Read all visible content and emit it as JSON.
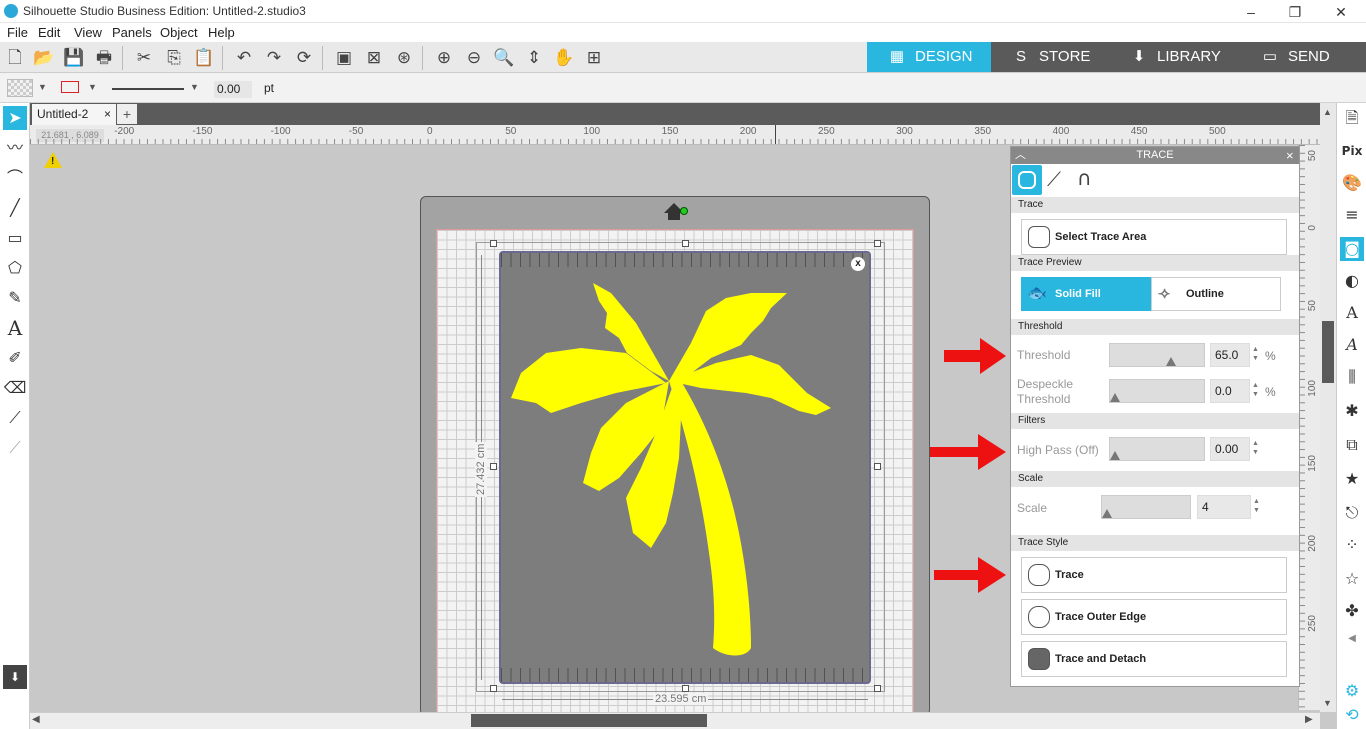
{
  "window": {
    "title": "Silhouette Studio Business Edition: Untitled-2.studio3",
    "min": "–",
    "restore": "❐",
    "close": "✕"
  },
  "menu": [
    "File",
    "Edit",
    "View",
    "Panels",
    "Object",
    "Help"
  ],
  "nav": {
    "design": "DESIGN",
    "store": "STORE",
    "library": "LIBRARY",
    "send": "SEND",
    "active_color": "#29b7e0"
  },
  "propbar": {
    "line_width": "0.00",
    "unit": "pt"
  },
  "doc": {
    "tab": "Untitled-2",
    "close": "×",
    "add": "+"
  },
  "coords": "21.681 , 6.089",
  "ruler_h": [
    "-200",
    "-150",
    "-100",
    "-50",
    "0",
    "50",
    "100",
    "150",
    "200",
    "250",
    "300",
    "350",
    "400",
    "450",
    "500"
  ],
  "ruler_v": [
    "50",
    "0",
    "50",
    "100",
    "150",
    "200",
    "250"
  ],
  "dims": {
    "height": "27.432 cm",
    "width": "23.595 cm"
  },
  "image_close": "x",
  "trace_panel": {
    "title": "TRACE",
    "close": "×",
    "sections": {
      "trace": "Trace",
      "preview": "Trace Preview",
      "threshold": "Threshold",
      "filters": "Filters",
      "scale": "Scale",
      "style": "Trace Style"
    },
    "select_area": "Select Trace Area",
    "preview": {
      "solid": "Solid Fill",
      "outline": "Outline"
    },
    "threshold": {
      "label": "Threshold",
      "value": "65.0",
      "unit": "%",
      "fraction": 0.65
    },
    "despeckle": {
      "label1": "Despeckle",
      "label2": "Threshold",
      "value": "0.0",
      "unit": "%",
      "fraction": 0.0
    },
    "highpass": {
      "label": "High Pass (Off)",
      "value": "0.00",
      "fraction": 0.0
    },
    "scale": {
      "label": "Scale",
      "value": "4",
      "fraction": 0.0
    },
    "buttons": {
      "trace": "Trace",
      "outer": "Trace Outer Edge",
      "detach": "Trace and Detach"
    }
  },
  "colors": {
    "accent": "#29b7e0",
    "trace_yellow": "#ffff00",
    "arrow_red": "#ee1111"
  }
}
